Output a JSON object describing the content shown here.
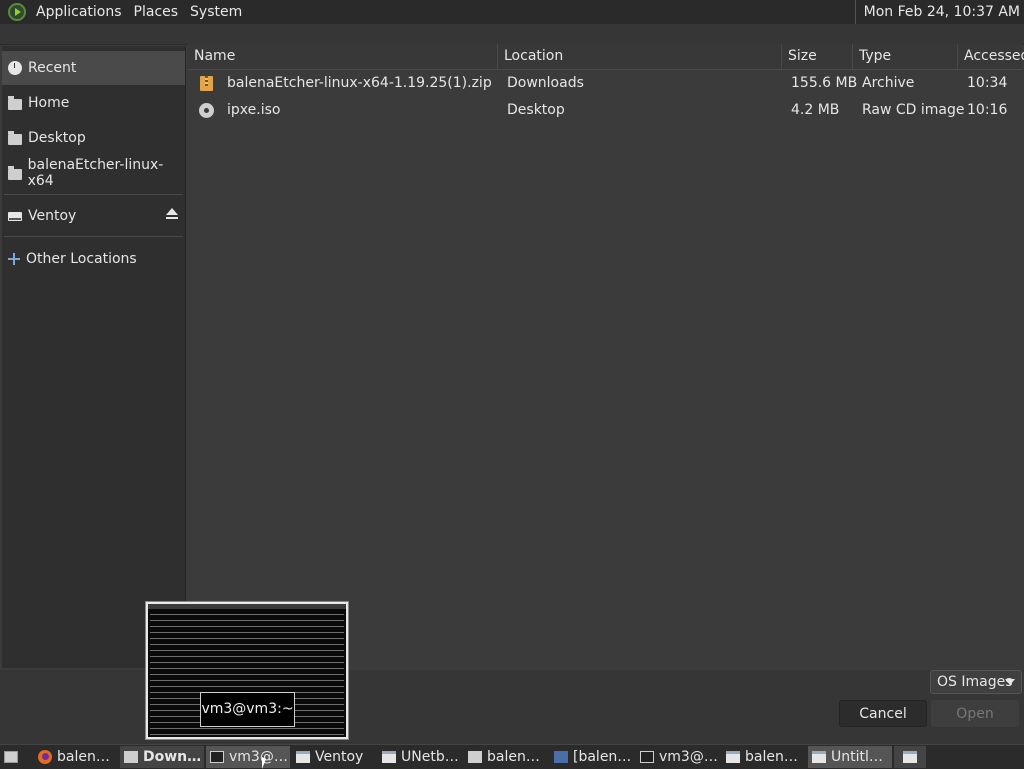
{
  "topbar": {
    "menus": [
      "Applications",
      "Places",
      "System"
    ],
    "clock": "Mon Feb 24, 10:37 AM"
  },
  "sidebar": {
    "items": [
      {
        "label": "Recent",
        "icon": "clock-icon"
      },
      {
        "label": "Home",
        "icon": "home-folder-icon"
      },
      {
        "label": "Desktop",
        "icon": "desktop-folder-icon"
      },
      {
        "label": "balenaEtcher-linux-x64",
        "icon": "folder-icon"
      },
      {
        "label": "Ventoy",
        "icon": "drive-icon"
      },
      {
        "label": "Other Locations",
        "icon": "plus-icon"
      }
    ]
  },
  "table": {
    "columns": [
      "Name",
      "Location",
      "Size",
      "Type",
      "Accessed"
    ],
    "rows": [
      {
        "name": "balenaEtcher-linux-x64-1.19.25(1).zip",
        "location": "Downloads",
        "size": "155.6 MB",
        "type": "Archive",
        "accessed": "10:34",
        "icon": "archive-icon"
      },
      {
        "name": "ipxe.iso",
        "location": "Desktop",
        "size": "4.2 MB",
        "type": "Raw CD image",
        "accessed": "10:16",
        "icon": "disc-icon"
      }
    ]
  },
  "footer": {
    "filter": "OS Images",
    "cancel": "Cancel",
    "open": "Open"
  },
  "preview": {
    "label": "vm3@vm3:~"
  },
  "taskbar": {
    "items": [
      "balen…",
      "Down…",
      "vm3@…",
      "Ventoy",
      "UNetb…",
      "balen…",
      "[balen…",
      "vm3@…",
      "balen…",
      "Untitl…"
    ]
  }
}
